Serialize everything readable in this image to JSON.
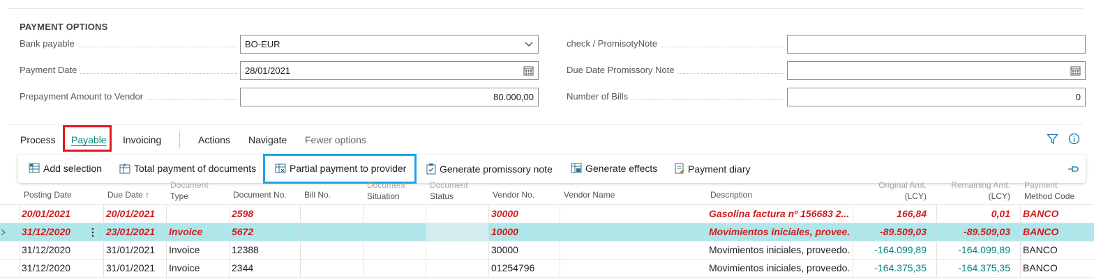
{
  "payment_options": {
    "title": "PAYMENT OPTIONS",
    "bank_payable": {
      "label": "Bank payable",
      "value": "BO-EUR"
    },
    "payment_date": {
      "label": "Payment Date",
      "value": "28/01/2021"
    },
    "prepayment": {
      "label": "Prepayment Amount to Vendor",
      "value": "80.000,00"
    },
    "check_note": {
      "label": "check / PromisotyNote",
      "value": ""
    },
    "due_date_note": {
      "label": "Due Date Promissory Note",
      "value": ""
    },
    "number_of_bills": {
      "label": "Number of Bills",
      "value": "0"
    }
  },
  "tabs": {
    "process": "Process",
    "payable": "Payable",
    "invoicing": "Invoicing",
    "actions": "Actions",
    "navigate": "Navigate",
    "fewer": "Fewer options"
  },
  "actions": {
    "add_selection": "Add selection",
    "total_payment": "Total payment of documents",
    "partial_payment": "Partial payment to provider",
    "generate_note": "Generate promissory note",
    "generate_effects": "Generate effects",
    "payment_diary": "Payment diary"
  },
  "columns": {
    "posting_date": "Posting Date",
    "due_date": "Due Date ↑",
    "doc_type_1": "Document",
    "doc_type_2": "Type",
    "doc_no": "Document No.",
    "bill_no": "Bill No.",
    "doc_sit_1": "Document",
    "doc_sit_2": "Situation",
    "doc_stat_1": "Document",
    "doc_stat_2": "Status",
    "vendor_no": "Vendor No.",
    "vendor_name": "Vendor Name",
    "description": "Description",
    "orig_1": "Original Amt.",
    "orig_2": "(LCY)",
    "rem_1": "Remaining Amt.",
    "rem_2": "(LCY)",
    "pm_1": "Payment",
    "pm_2": "Method Code"
  },
  "rows": [
    {
      "posting": "20/01/2021",
      "due": "20/01/2021",
      "type": "",
      "doc": "2598",
      "vendor": "30000",
      "desc": "Gasolina factura nº 156683 2...",
      "orig": "166,84",
      "rem": "0,01",
      "pm": "BANCO"
    },
    {
      "posting": "31/12/2020",
      "due": "23/01/2021",
      "type": "Invoice",
      "doc": "5672",
      "vendor": "10000",
      "desc": "Movimientos iniciales, provee...",
      "orig": "-89.509,03",
      "rem": "-89.509,03",
      "pm": "BANCO"
    },
    {
      "posting": "31/12/2020",
      "due": "31/01/2021",
      "type": "Invoice",
      "doc": "12388",
      "vendor": "30000",
      "desc": "Movimientos iniciales, proveedo...",
      "orig": "-164.099,89",
      "rem": "-164.099,89",
      "pm": "BANCO"
    },
    {
      "posting": "31/12/2020",
      "due": "31/01/2021",
      "type": "Invoice",
      "doc": "2344",
      "vendor": "01254796",
      "desc": "Movimientos iniciales, proveedo...",
      "orig": "-164.375,35",
      "rem": "-164.375,35",
      "pm": "BANCO"
    }
  ],
  "colors": {
    "accent": "#00847c",
    "highlight_red": "#e0161d",
    "highlight_blue": "#19a5e0",
    "selected_row": "#aee6ea",
    "red_text": "#d11c1c"
  }
}
